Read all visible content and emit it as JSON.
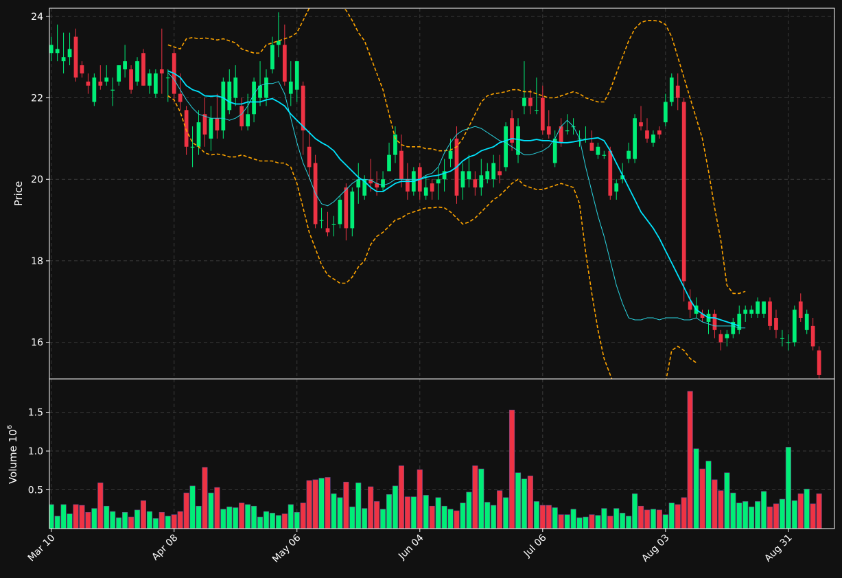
{
  "chart_data": {
    "type": "candlestick",
    "colors": {
      "background": "#111111",
      "up": "#00ee77",
      "down": "#ee3344",
      "ma_slow": "#00e5ff",
      "ma_fast": "#29d4e0",
      "bands": "#ffa500",
      "grid": "#3a3a3a",
      "text": "#ffffff"
    },
    "price_panel": {
      "ylabel": "Price",
      "ylim": [
        15.1,
        24.2
      ],
      "yticks": [
        16,
        18,
        20,
        22,
        24
      ]
    },
    "volume_panel": {
      "ylabel": "Volume",
      "scale_label": "10",
      "scale_exp": "6",
      "ylim": [
        0,
        1.93
      ],
      "yticks": [
        0.5,
        1.0,
        1.5
      ],
      "ytick_labels": [
        "0.5",
        "1.0",
        "1.5"
      ]
    },
    "xlim": [
      -0.3,
      127.5
    ],
    "x_ticks": [
      {
        "index": 0,
        "label": "Mar 10"
      },
      {
        "index": 20,
        "label": "Apr 08"
      },
      {
        "index": 40,
        "label": "May 06"
      },
      {
        "index": 60,
        "label": "Jun 04"
      },
      {
        "index": 80,
        "label": "Jul 06"
      },
      {
        "index": 100,
        "label": "Aug 03"
      },
      {
        "index": 120,
        "label": "Aug 31"
      }
    ],
    "candles": [
      [
        23.1,
        23.3,
        23.5,
        22.9
      ],
      [
        23.1,
        23.2,
        23.8,
        22.9
      ],
      [
        22.9,
        23.0,
        23.6,
        22.6
      ],
      [
        23.0,
        23.2,
        23.6,
        22.8
      ],
      [
        23.5,
        22.5,
        23.7,
        22.4
      ],
      [
        22.8,
        22.6,
        22.9,
        22.5
      ],
      [
        22.4,
        22.3,
        22.6,
        22.1
      ],
      [
        21.9,
        22.5,
        22.6,
        21.8
      ],
      [
        22.4,
        22.3,
        22.8,
        22.2
      ],
      [
        22.4,
        22.5,
        22.8,
        22.3
      ],
      [
        22.2,
        22.2,
        22.5,
        21.8
      ],
      [
        22.4,
        22.8,
        22.8,
        22.3
      ],
      [
        22.7,
        22.9,
        23.3,
        22.5
      ],
      [
        22.7,
        22.2,
        22.8,
        22.1
      ],
      [
        22.4,
        22.9,
        23.0,
        22.3
      ],
      [
        23.1,
        22.3,
        23.2,
        22.3
      ],
      [
        22.3,
        22.6,
        22.7,
        22.1
      ],
      [
        22.1,
        22.6,
        22.7,
        22.0
      ],
      [
        22.7,
        22.6,
        23.7,
        22.1
      ],
      [
        22.5,
        22.5,
        22.7,
        21.9
      ],
      [
        23.1,
        22.1,
        23.2,
        21.9
      ],
      [
        22.1,
        21.9,
        22.6,
        21.7
      ],
      [
        21.7,
        20.8,
        21.8,
        20.6
      ],
      [
        20.8,
        20.8,
        21.3,
        20.3
      ],
      [
        20.8,
        21.4,
        21.7,
        20.6
      ],
      [
        21.6,
        21.1,
        22.0,
        20.8
      ],
      [
        21.0,
        21.5,
        21.8,
        20.7
      ],
      [
        21.5,
        21.2,
        22.1,
        21.0
      ],
      [
        21.2,
        22.4,
        22.5,
        21.0
      ],
      [
        21.7,
        22.4,
        22.7,
        21.6
      ],
      [
        22.0,
        22.5,
        22.8,
        21.8
      ],
      [
        21.8,
        21.3,
        22.0,
        21.2
      ],
      [
        21.3,
        21.6,
        22.1,
        21.2
      ],
      [
        21.6,
        22.4,
        22.5,
        21.4
      ],
      [
        22.0,
        22.3,
        22.9,
        21.8
      ],
      [
        22.0,
        22.5,
        22.7,
        21.8
      ],
      [
        22.7,
        23.3,
        23.5,
        22.6
      ],
      [
        23.3,
        23.4,
        24.1,
        23.0
      ],
      [
        23.3,
        22.4,
        23.8,
        22.3
      ],
      [
        22.1,
        22.4,
        22.9,
        21.8
      ],
      [
        22.2,
        22.9,
        22.9,
        21.9
      ],
      [
        22.3,
        21.2,
        22.4,
        20.6
      ],
      [
        20.8,
        20.3,
        21.2,
        20.0
      ],
      [
        20.4,
        18.9,
        20.6,
        18.8
      ],
      [
        19.0,
        19.0,
        19.3,
        18.8
      ],
      [
        18.8,
        18.7,
        19.2,
        18.6
      ],
      [
        18.9,
        18.9,
        19.1,
        18.6
      ],
      [
        18.9,
        19.5,
        19.6,
        18.8
      ],
      [
        19.8,
        18.8,
        19.9,
        18.5
      ],
      [
        18.8,
        19.7,
        19.8,
        18.6
      ],
      [
        19.8,
        20.0,
        20.4,
        19.4
      ],
      [
        19.6,
        20.0,
        20.1,
        19.5
      ],
      [
        20.0,
        19.9,
        20.5,
        19.7
      ],
      [
        19.9,
        19.8,
        20.2,
        19.6
      ],
      [
        19.8,
        20.0,
        20.2,
        19.7
      ],
      [
        20.2,
        20.6,
        20.9,
        20.2
      ],
      [
        20.6,
        21.1,
        21.3,
        20.4
      ],
      [
        20.7,
        20.0,
        21.1,
        19.8
      ],
      [
        20.0,
        19.7,
        20.4,
        19.5
      ],
      [
        19.7,
        20.2,
        20.3,
        19.6
      ],
      [
        20.3,
        19.7,
        20.4,
        19.5
      ],
      [
        19.6,
        19.8,
        20.1,
        19.5
      ],
      [
        19.9,
        19.7,
        20.0,
        19.5
      ],
      [
        19.9,
        20.0,
        20.3,
        19.5
      ],
      [
        20.0,
        20.2,
        20.5,
        19.7
      ],
      [
        20.5,
        20.7,
        21.0,
        20.3
      ],
      [
        21.0,
        19.6,
        21.3,
        19.4
      ],
      [
        19.8,
        20.2,
        20.4,
        19.5
      ],
      [
        20.0,
        20.2,
        20.6,
        19.8
      ],
      [
        20.0,
        19.8,
        20.2,
        19.6
      ],
      [
        19.8,
        20.1,
        20.5,
        19.6
      ],
      [
        20.0,
        20.2,
        20.4,
        19.9
      ],
      [
        20.0,
        20.4,
        20.6,
        19.8
      ],
      [
        20.2,
        20.1,
        20.6,
        19.9
      ],
      [
        20.3,
        21.3,
        21.4,
        20.2
      ],
      [
        21.5,
        20.9,
        21.7,
        20.7
      ],
      [
        20.6,
        21.3,
        21.5,
        20.4
      ],
      [
        21.8,
        22.0,
        22.9,
        21.6
      ],
      [
        22.0,
        21.8,
        22.2,
        21.6
      ],
      [
        21.7,
        21.7,
        22.5,
        21.6
      ],
      [
        22.0,
        21.2,
        22.3,
        21.1
      ],
      [
        21.3,
        21.1,
        21.7,
        21.0
      ],
      [
        20.4,
        21.0,
        21.2,
        20.3
      ],
      [
        21.3,
        20.9,
        21.5,
        20.8
      ],
      [
        21.2,
        21.2,
        21.6,
        21.1
      ],
      [
        21.3,
        21.3,
        21.5,
        21.1
      ],
      [
        21.0,
        21.0,
        21.2,
        20.8
      ],
      [
        21.0,
        21.0,
        21.3,
        20.9
      ],
      [
        20.9,
        20.7,
        21.2,
        20.7
      ],
      [
        20.6,
        20.8,
        20.9,
        20.5
      ],
      [
        20.6,
        20.6,
        20.7,
        20.5
      ],
      [
        20.7,
        19.6,
        20.8,
        19.5
      ],
      [
        19.7,
        19.9,
        20.0,
        19.5
      ],
      [
        20.0,
        20.1,
        20.4,
        19.9
      ],
      [
        20.5,
        20.7,
        20.9,
        20.4
      ],
      [
        20.5,
        21.5,
        21.6,
        20.4
      ],
      [
        21.4,
        21.3,
        21.8,
        21.2
      ],
      [
        21.2,
        21.0,
        21.5,
        20.9
      ],
      [
        20.9,
        21.1,
        21.2,
        20.8
      ],
      [
        21.2,
        21.1,
        21.3,
        21.0
      ],
      [
        21.4,
        21.9,
        22.1,
        21.3
      ],
      [
        21.9,
        22.5,
        22.6,
        21.8
      ],
      [
        22.3,
        22.0,
        22.6,
        21.7
      ],
      [
        21.9,
        17.5,
        22.0,
        17.0
      ],
      [
        17.0,
        16.8,
        17.3,
        16.6
      ],
      [
        16.7,
        16.9,
        17.1,
        16.6
      ],
      [
        16.7,
        16.6,
        16.8,
        16.5
      ],
      [
        16.5,
        16.7,
        16.8,
        16.2
      ],
      [
        16.7,
        16.3,
        16.8,
        16.1
      ],
      [
        16.2,
        16.0,
        16.3,
        15.8
      ],
      [
        16.1,
        16.2,
        16.3,
        15.9
      ],
      [
        16.2,
        16.5,
        16.6,
        16.1
      ],
      [
        16.3,
        16.7,
        16.9,
        16.2
      ],
      [
        16.7,
        16.8,
        16.9,
        16.5
      ],
      [
        16.7,
        16.8,
        16.9,
        16.6
      ],
      [
        16.7,
        17.0,
        17.1,
        16.6
      ],
      [
        16.7,
        17.0,
        17.0,
        16.6
      ],
      [
        17.0,
        16.4,
        17.1,
        16.3
      ],
      [
        16.6,
        16.3,
        16.8,
        16.1
      ],
      [
        16.1,
        16.1,
        16.3,
        15.9
      ],
      [
        16.0,
        16.0,
        16.2,
        15.8
      ],
      [
        16.0,
        16.8,
        16.9,
        15.9
      ],
      [
        17.0,
        16.6,
        17.2,
        16.5
      ],
      [
        16.3,
        16.7,
        16.8,
        16.2
      ],
      [
        16.4,
        15.9,
        16.6,
        15.8
      ],
      [
        15.8,
        15.2,
        15.9,
        15.1
      ]
    ],
    "volume": [
      0.31,
      0.16,
      0.31,
      0.19,
      0.31,
      0.3,
      0.21,
      0.26,
      0.59,
      0.29,
      0.22,
      0.14,
      0.21,
      0.15,
      0.24,
      0.36,
      0.22,
      0.13,
      0.21,
      0.16,
      0.18,
      0.22,
      0.46,
      0.55,
      0.29,
      0.79,
      0.46,
      0.53,
      0.25,
      0.28,
      0.27,
      0.33,
      0.31,
      0.29,
      0.15,
      0.22,
      0.2,
      0.17,
      0.19,
      0.31,
      0.21,
      0.33,
      0.62,
      0.63,
      0.65,
      0.66,
      0.45,
      0.4,
      0.6,
      0.28,
      0.59,
      0.26,
      0.54,
      0.35,
      0.25,
      0.44,
      0.55,
      0.81,
      0.41,
      0.41,
      0.76,
      0.43,
      0.29,
      0.4,
      0.29,
      0.25,
      0.23,
      0.33,
      0.47,
      0.81,
      0.77,
      0.34,
      0.3,
      0.49,
      0.4,
      1.53,
      0.72,
      0.64,
      0.68,
      0.35,
      0.3,
      0.3,
      0.27,
      0.18,
      0.18,
      0.25,
      0.14,
      0.15,
      0.18,
      0.17,
      0.26,
      0.16,
      0.26,
      0.2,
      0.16,
      0.45,
      0.29,
      0.24,
      0.25,
      0.24,
      0.18,
      0.33,
      0.31,
      0.4,
      1.77,
      1.03,
      0.77,
      0.87,
      0.63,
      0.49,
      0.72,
      0.46,
      0.33,
      0.35,
      0.28,
      0.35,
      0.48,
      0.28,
      0.32,
      0.38,
      1.05,
      0.36,
      0.45,
      0.51,
      0.32,
      0.45,
      0.36
    ],
    "ma_slow": [
      null,
      null,
      null,
      null,
      null,
      null,
      null,
      null,
      null,
      null,
      null,
      null,
      null,
      null,
      null,
      null,
      null,
      null,
      null,
      22.66,
      22.6,
      22.5,
      22.3,
      22.2,
      22.15,
      22.05,
      22.04,
      22.05,
      22.0,
      21.9,
      21.85,
      21.85,
      21.9,
      21.9,
      21.9,
      21.95,
      21.98,
      21.9,
      21.8,
      21.6,
      21.45,
      21.3,
      21.15,
      21.0,
      20.9,
      20.82,
      20.7,
      20.5,
      20.35,
      20.2,
      20.05,
      19.95,
      19.8,
      19.7,
      19.7,
      19.8,
      19.9,
      19.95,
      19.95,
      19.95,
      20.0,
      20.05,
      20.08,
      20.1,
      20.15,
      20.2,
      20.3,
      20.45,
      20.55,
      20.6,
      20.7,
      20.75,
      20.8,
      20.9,
      20.95,
      21.0,
      20.98,
      20.95,
      20.95,
      20.98,
      20.95,
      20.95,
      20.92,
      20.9,
      20.9,
      20.92,
      20.95,
      20.98,
      21.0,
      21.02,
      20.95,
      20.7,
      20.4,
      20.1,
      19.8,
      19.5,
      19.2,
      19.0,
      18.8,
      18.55,
      18.25,
      17.95,
      17.65,
      17.35,
      17.05,
      16.8,
      16.7,
      16.6,
      16.6,
      16.55,
      16.5,
      16.45,
      16.4
    ],
    "ma_fast": [
      null,
      null,
      null,
      null,
      null,
      null,
      null,
      null,
      null,
      null,
      null,
      null,
      null,
      null,
      null,
      null,
      null,
      null,
      null,
      22.62,
      22.45,
      22.2,
      21.95,
      21.75,
      21.6,
      21.55,
      21.5,
      21.5,
      21.5,
      21.45,
      21.5,
      21.6,
      21.8,
      22.1,
      22.3,
      22.35,
      22.35,
      22.4,
      22.1,
      21.5,
      20.9,
      20.4,
      20.05,
      19.65,
      19.4,
      19.35,
      19.45,
      19.6,
      19.75,
      19.9,
      20.0,
      20.0,
      19.98,
      19.9,
      19.85,
      19.9,
      20.0,
      20.0,
      20.0,
      20.0,
      20.0,
      20.1,
      20.15,
      20.3,
      20.65,
      20.9,
      21.1,
      21.2,
      21.25,
      21.3,
      21.25,
      21.15,
      21.05,
      20.95,
      20.9,
      20.8,
      20.7,
      20.6,
      20.6,
      20.65,
      20.7,
      20.8,
      21.0,
      21.3,
      21.45,
      21.3,
      21.0,
      20.3,
      19.7,
      19.1,
      18.6,
      18.0,
      17.4,
      16.95,
      16.6,
      16.55,
      16.55,
      16.6,
      16.6,
      16.55,
      16.6,
      16.6,
      16.6,
      16.55,
      16.55,
      16.6,
      16.5,
      16.45,
      16.4,
      16.4,
      16.4,
      16.4,
      16.35,
      16.35
    ],
    "band_upper": [
      null,
      null,
      null,
      null,
      null,
      null,
      null,
      null,
      null,
      null,
      null,
      null,
      null,
      null,
      null,
      null,
      null,
      null,
      null,
      23.3,
      23.25,
      23.2,
      23.45,
      23.48,
      23.45,
      23.47,
      23.45,
      23.42,
      23.45,
      23.4,
      23.35,
      23.2,
      23.15,
      23.1,
      23.1,
      23.3,
      23.35,
      23.4,
      23.45,
      23.5,
      23.6,
      23.9,
      24.2,
      24.5,
      24.8,
      24.6,
      24.4,
      24.25,
      24.15,
      23.9,
      23.6,
      23.4,
      23.0,
      22.6,
      22.2,
      21.6,
      21.0,
      20.85,
      20.8,
      20.8,
      20.8,
      20.75,
      20.75,
      20.7,
      20.7,
      20.72,
      20.8,
      21.0,
      21.3,
      21.6,
      21.9,
      22.05,
      22.1,
      22.12,
      22.15,
      22.2,
      22.2,
      22.15,
      22.15,
      22.1,
      22.05,
      22.0,
      22.0,
      22.05,
      22.1,
      22.15,
      22.1,
      22.0,
      21.95,
      21.9,
      21.9,
      22.2,
      22.6,
      23.0,
      23.4,
      23.7,
      23.85,
      23.9,
      23.9,
      23.88,
      23.8,
      23.5,
      23.0,
      22.5,
      22.0,
      21.5,
      21.0,
      20.2,
      19.3,
      18.5,
      17.4,
      17.2,
      17.2,
      17.25
    ],
    "band_lower": [
      null,
      null,
      null,
      null,
      null,
      null,
      null,
      null,
      null,
      null,
      null,
      null,
      null,
      null,
      null,
      null,
      null,
      null,
      null,
      22.05,
      21.95,
      21.65,
      21.2,
      20.9,
      20.8,
      20.65,
      20.6,
      20.62,
      20.6,
      20.55,
      20.55,
      20.6,
      20.55,
      20.5,
      20.45,
      20.45,
      20.45,
      20.4,
      20.4,
      20.3,
      19.9,
      19.3,
      18.7,
      18.3,
      17.9,
      17.65,
      17.55,
      17.45,
      17.45,
      17.6,
      17.85,
      18.0,
      18.4,
      18.6,
      18.7,
      18.85,
      19.0,
      19.05,
      19.15,
      19.2,
      19.25,
      19.3,
      19.3,
      19.32,
      19.3,
      19.2,
      19.05,
      18.9,
      18.95,
      19.05,
      19.2,
      19.35,
      19.5,
      19.6,
      19.75,
      19.9,
      20.0,
      19.85,
      19.8,
      19.75,
      19.75,
      19.8,
      19.85,
      19.9,
      19.85,
      19.8,
      19.4,
      18.2,
      17.2,
      16.3,
      15.6,
      15.2,
      14.8,
      14.4,
      14.2,
      14.1,
      14.1,
      14.1,
      14.3,
      14.6,
      15.0,
      15.8,
      15.9,
      15.8,
      15.6,
      15.5
    ]
  }
}
